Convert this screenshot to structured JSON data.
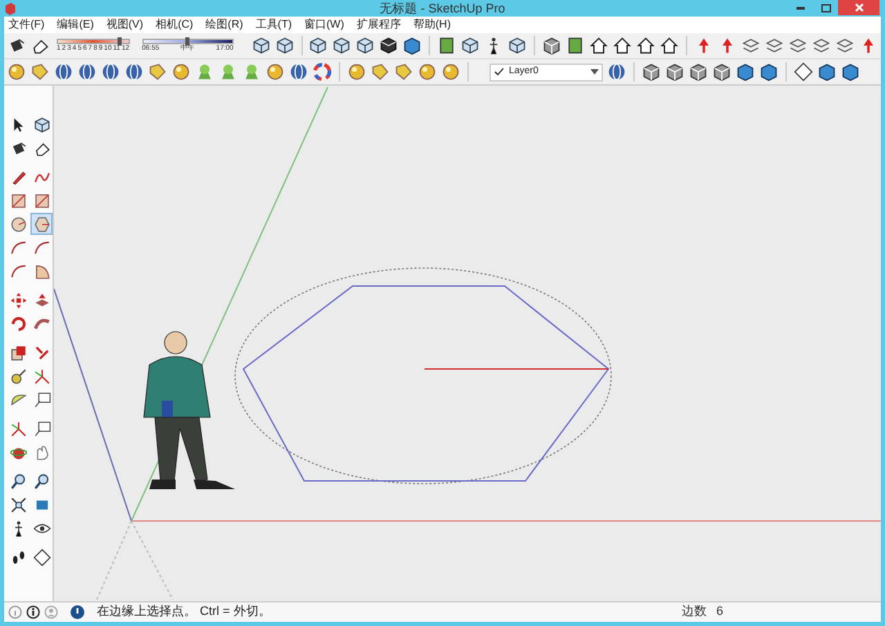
{
  "window": {
    "title": "无标题 - SketchUp Pro"
  },
  "menu": [
    "文件(F)",
    "编辑(E)",
    "视图(V)",
    "相机(C)",
    "绘图(R)",
    "工具(T)",
    "窗口(W)",
    "扩展程序",
    "帮助(H)"
  ],
  "shadow_settings": {
    "month_slider": {
      "level": 0.87
    },
    "time_slider": {
      "level": 0.5
    },
    "month_labels": [
      "1",
      "2",
      "3",
      "4",
      "5",
      "6",
      "7",
      "8",
      "9",
      "10",
      "11",
      "12"
    ],
    "time_labels": [
      "06:55",
      "中午",
      "17:00"
    ]
  },
  "layer_dropdown": {
    "value": "Layer0"
  },
  "left_toolbar": {
    "tools": [
      {
        "selected": false
      },
      {
        "selected": false
      },
      {
        "selected": false
      },
      {
        "selected": false
      },
      {
        "selected": false
      },
      {
        "selected": false
      },
      {
        "selected": false
      },
      {
        "selected": false
      },
      {
        "selected": false
      },
      {
        "selected": true
      },
      {
        "selected": false
      },
      {
        "selected": false
      },
      {
        "selected": false
      },
      {
        "selected": false
      },
      {
        "selected": false
      },
      {
        "selected": false
      },
      {
        "selected": false
      },
      {
        "selected": false
      },
      {
        "selected": false
      },
      {
        "selected": false
      },
      {
        "selected": false
      },
      {
        "selected": false
      },
      {
        "selected": false
      },
      {
        "selected": false
      },
      {
        "selected": false
      },
      {
        "selected": false
      },
      {
        "selected": false
      },
      {
        "selected": false
      },
      {
        "selected": false
      },
      {
        "selected": false
      },
      {
        "selected": false
      },
      {
        "selected": false
      },
      {
        "selected": false
      },
      {
        "selected": false
      }
    ]
  },
  "status_bar": {
    "message": "在边缘上选择点。 Ctrl = 外切。",
    "measurement_label": "边数",
    "measurement_value": "6"
  }
}
